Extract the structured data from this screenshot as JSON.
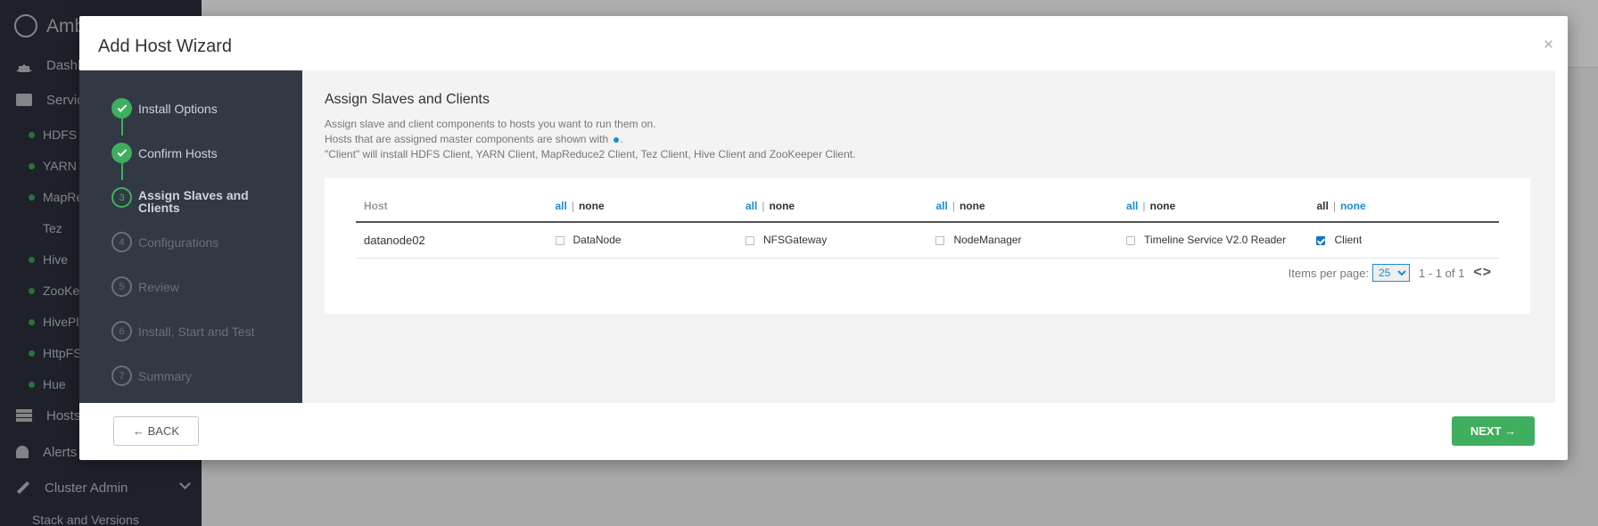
{
  "app": {
    "logo_text": "Amb",
    "nav": [
      {
        "label": "Dashbo",
        "icon": "home-icon"
      },
      {
        "label": "Service",
        "icon": "briefcase-icon"
      }
    ],
    "services": [
      "HDFS",
      "YARN",
      "MapRe",
      "Tez",
      "Hive",
      "ZooKee",
      "HivePlu",
      "HttpFS",
      "Hue"
    ],
    "hosts_label": "Hosts",
    "alerts_label": "Alerts",
    "cluster_admin_label": "Cluster Admin",
    "stack_label": "Stack and Versions"
  },
  "wizard": {
    "title": "Add Host Wizard",
    "close": "×",
    "steps": [
      {
        "num": "1",
        "label": "Install Options",
        "state": "done"
      },
      {
        "num": "2",
        "label": "Confirm Hosts",
        "state": "done"
      },
      {
        "num": "3",
        "label": "Assign Slaves and Clients",
        "state": "current"
      },
      {
        "num": "4",
        "label": "Configurations",
        "state": "pending"
      },
      {
        "num": "5",
        "label": "Review",
        "state": "pending"
      },
      {
        "num": "6",
        "label": "Install, Start and Test",
        "state": "pending"
      },
      {
        "num": "7",
        "label": "Summary",
        "state": "pending"
      }
    ],
    "heading": "Assign Slaves and Clients",
    "desc1": "Assign slave and client components to hosts you want to run them on.",
    "desc2a": "Hosts that are assigned master components are shown with",
    "desc2b": ".",
    "desc3": "\"Client\" will install HDFS Client, YARN Client, MapReduce2 Client, Tez Client, Hive Client and ZooKeeper Client.",
    "table": {
      "host_header": "Host",
      "all": "all",
      "none": "none",
      "sep": "|",
      "rows": [
        {
          "host": "datanode02",
          "components": [
            {
              "label": "DataNode",
              "checked": false
            },
            {
              "label": "NFSGateway",
              "checked": false
            },
            {
              "label": "NodeManager",
              "checked": false
            },
            {
              "label": "Timeline Service V2.0 Reader",
              "checked": false
            },
            {
              "label": "Client",
              "checked": true
            }
          ]
        }
      ]
    },
    "pager": {
      "items_per_page_label": "Items per page:",
      "page_size": "25",
      "range": "1 - 1 of 1",
      "arrows": "<>"
    },
    "back_label": "← BACK",
    "next_label": "NEXT →",
    "colors": {
      "accent_green": "#3fae5e",
      "link_blue": "#1a8cd8"
    }
  }
}
